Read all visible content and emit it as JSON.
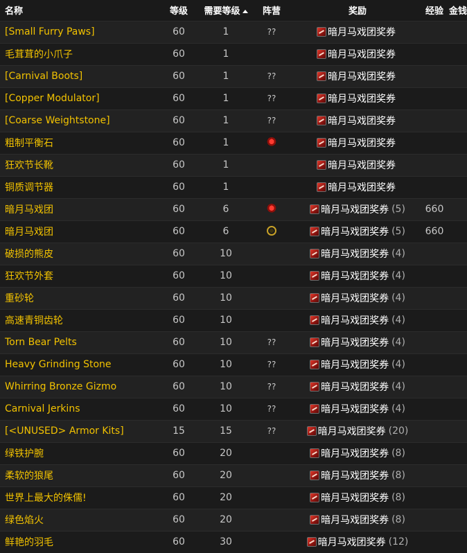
{
  "headers": {
    "name": "名称",
    "level": "等级",
    "req_level": "需要等级",
    "side": "阵营",
    "reward": "奖励",
    "xp": "经验",
    "money": "金钱"
  },
  "reward_name": "暗月马戏团奖券",
  "rows": [
    {
      "name": "[Small Furry Paws]",
      "level": "60",
      "req": "1",
      "side": "??",
      "reward": "暗月马戏团奖券",
      "count": "",
      "xp": ""
    },
    {
      "name": "毛茸茸的小爪子",
      "level": "60",
      "req": "1",
      "side": "",
      "reward": "暗月马戏团奖券",
      "count": "",
      "xp": ""
    },
    {
      "name": "[Carnival Boots]",
      "level": "60",
      "req": "1",
      "side": "??",
      "reward": "暗月马戏团奖券",
      "count": "",
      "xp": ""
    },
    {
      "name": "[Copper Modulator]",
      "level": "60",
      "req": "1",
      "side": "??",
      "reward": "暗月马戏团奖券",
      "count": "",
      "xp": ""
    },
    {
      "name": "[Coarse Weightstone]",
      "level": "60",
      "req": "1",
      "side": "??",
      "reward": "暗月马戏团奖券",
      "count": "",
      "xp": ""
    },
    {
      "name": "粗制平衡石",
      "level": "60",
      "req": "1",
      "side": "horde",
      "reward": "暗月马戏团奖券",
      "count": "",
      "xp": ""
    },
    {
      "name": "狂欢节长靴",
      "level": "60",
      "req": "1",
      "side": "",
      "reward": "暗月马戏团奖券",
      "count": "",
      "xp": ""
    },
    {
      "name": "铜质调节器",
      "level": "60",
      "req": "1",
      "side": "",
      "reward": "暗月马戏团奖券",
      "count": "",
      "xp": ""
    },
    {
      "name": "暗月马戏团",
      "level": "60",
      "req": "6",
      "side": "horde",
      "reward": "暗月马戏团奖券",
      "count": "(5)",
      "xp": "660"
    },
    {
      "name": "暗月马戏团",
      "level": "60",
      "req": "6",
      "side": "alliance",
      "reward": "暗月马戏团奖券",
      "count": "(5)",
      "xp": "660"
    },
    {
      "name": "破损的熊皮",
      "level": "60",
      "req": "10",
      "side": "",
      "reward": "暗月马戏团奖券",
      "count": "(4)",
      "xp": ""
    },
    {
      "name": "狂欢节外套",
      "level": "60",
      "req": "10",
      "side": "",
      "reward": "暗月马戏团奖券",
      "count": "(4)",
      "xp": ""
    },
    {
      "name": "重砂轮",
      "level": "60",
      "req": "10",
      "side": "",
      "reward": "暗月马戏团奖券",
      "count": "(4)",
      "xp": ""
    },
    {
      "name": "高速青铜齿轮",
      "level": "60",
      "req": "10",
      "side": "",
      "reward": "暗月马戏团奖券",
      "count": "(4)",
      "xp": ""
    },
    {
      "name": "Torn Bear Pelts",
      "level": "60",
      "req": "10",
      "side": "??",
      "reward": "暗月马戏团奖券",
      "count": "(4)",
      "xp": ""
    },
    {
      "name": "Heavy Grinding Stone",
      "level": "60",
      "req": "10",
      "side": "??",
      "reward": "暗月马戏团奖券",
      "count": "(4)",
      "xp": ""
    },
    {
      "name": "Whirring Bronze Gizmo",
      "level": "60",
      "req": "10",
      "side": "??",
      "reward": "暗月马戏团奖券",
      "count": "(4)",
      "xp": ""
    },
    {
      "name": "Carnival Jerkins",
      "level": "60",
      "req": "10",
      "side": "??",
      "reward": "暗月马戏团奖券",
      "count": "(4)",
      "xp": ""
    },
    {
      "name": "[<UNUSED> Armor Kits]",
      "level": "15",
      "req": "15",
      "side": "??",
      "reward": "暗月马戏团奖券",
      "count": "(20)",
      "xp": ""
    },
    {
      "name": "绿铁护腕",
      "level": "60",
      "req": "20",
      "side": "",
      "reward": "暗月马戏团奖券",
      "count": "(8)",
      "xp": ""
    },
    {
      "name": "柔软的狼尾",
      "level": "60",
      "req": "20",
      "side": "",
      "reward": "暗月马戏团奖券",
      "count": "(8)",
      "xp": ""
    },
    {
      "name": "世界上最大的侏儒!",
      "level": "60",
      "req": "20",
      "side": "",
      "reward": "暗月马戏团奖券",
      "count": "(8)",
      "xp": ""
    },
    {
      "name": "绿色焰火",
      "level": "60",
      "req": "20",
      "side": "",
      "reward": "暗月马戏团奖券",
      "count": "(8)",
      "xp": ""
    },
    {
      "name": "鲜艳的羽毛",
      "level": "60",
      "req": "30",
      "side": "",
      "reward": "暗月马戏团奖券",
      "count": "(12)",
      "xp": ""
    }
  ]
}
